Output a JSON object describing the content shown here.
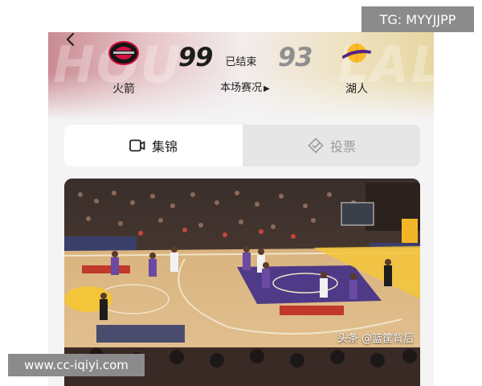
{
  "header": {
    "home_team": {
      "name": "火箭",
      "score": "99",
      "bg_word": "HOU"
    },
    "away_team": {
      "name": "湖人",
      "score": "93",
      "bg_word": "LAL"
    },
    "status": "已结束",
    "detail_link": "本场赛况",
    "home_score_color": "#1c1c1c",
    "away_score_color": "#8f8f8f"
  },
  "tabs": [
    {
      "label": "集锦",
      "icon": "video-icon",
      "active": true
    },
    {
      "label": "投票",
      "icon": "vote-icon",
      "active": false
    }
  ],
  "video": {
    "watermark": "头条 @篮筐背后",
    "scene": "basketball-court-highlight"
  },
  "overlays": {
    "tg_label": "TG: MYYJJPP",
    "url_label": "www.cc-iqiyi.com"
  }
}
